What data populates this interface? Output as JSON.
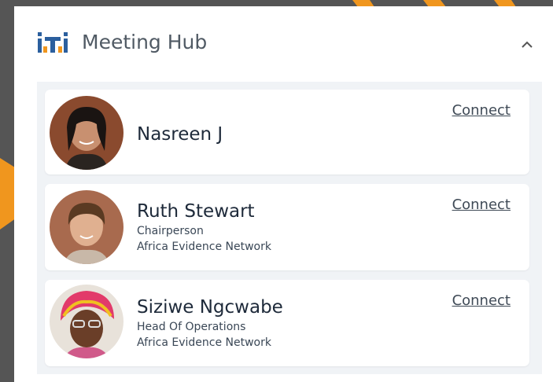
{
  "header": {
    "title": "Meeting Hub",
    "logo_icon": "iti-logo-icon",
    "collapse_icon": "chevron-up-icon"
  },
  "colors": {
    "accent_orange": "#f0961e",
    "background": "#555555",
    "panel": "#ffffff",
    "list_bg": "#f0f3f6",
    "text_dark": "#1e2a3a"
  },
  "members": [
    {
      "name": "Nasreen J",
      "role": "",
      "org": "",
      "connect_label": "Connect"
    },
    {
      "name": "Ruth Stewart",
      "role": "Chairperson",
      "org": "Africa Evidence Network",
      "connect_label": "Connect"
    },
    {
      "name": "Siziwe Ngcwabe",
      "role": "Head Of Operations",
      "org": "Africa Evidence Network",
      "connect_label": "Connect"
    }
  ]
}
